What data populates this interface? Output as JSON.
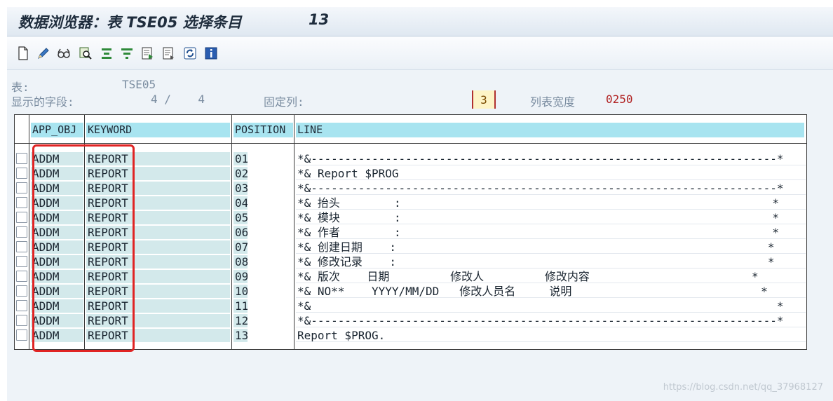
{
  "title": {
    "text": "数据浏览器：表 TSE05 选择条目",
    "count": "13"
  },
  "toolbar": {
    "buttons": [
      {
        "name": "new-page-icon"
      },
      {
        "name": "pencil-icon"
      },
      {
        "name": "glasses-icon"
      },
      {
        "name": "magnifier-icon"
      },
      {
        "name": "sort-ascending-icon"
      },
      {
        "name": "filter-icon"
      },
      {
        "name": "export-icon"
      },
      {
        "name": "detail-icon"
      },
      {
        "name": "refresh-icon"
      },
      {
        "name": "info-icon"
      }
    ]
  },
  "info": {
    "table_label": "表:",
    "table_value": "TSE05",
    "fields_label": "显示的字段:",
    "fields_value": "4 /    4",
    "fixed_cols_label": "固定列:",
    "fixed_cols_value": "3",
    "list_width_label": "列表宽度",
    "list_width_value": "0250"
  },
  "grid": {
    "headers": [
      "APP_OBJ",
      "KEYWORD",
      "POSITION",
      "LINE"
    ],
    "rows": [
      {
        "app_obj": "ADDM",
        "keyword": "REPORT",
        "position": "01",
        "line": "*&---------------------------------------------------------------------*"
      },
      {
        "app_obj": "ADDM",
        "keyword": "REPORT",
        "position": "02",
        "line": "*& Report $PROG"
      },
      {
        "app_obj": "ADDM",
        "keyword": "REPORT",
        "position": "03",
        "line": "*&---------------------------------------------------------------------*"
      },
      {
        "app_obj": "ADDM",
        "keyword": "REPORT",
        "position": "04",
        "line": "*& 抬头        :                                                       *"
      },
      {
        "app_obj": "ADDM",
        "keyword": "REPORT",
        "position": "05",
        "line": "*& 模块        :                                                       *"
      },
      {
        "app_obj": "ADDM",
        "keyword": "REPORT",
        "position": "06",
        "line": "*& 作者        :                                                       *"
      },
      {
        "app_obj": "ADDM",
        "keyword": "REPORT",
        "position": "07",
        "line": "*& 创建日期    :                                                       *"
      },
      {
        "app_obj": "ADDM",
        "keyword": "REPORT",
        "position": "08",
        "line": "*& 修改记录    :                                                       *"
      },
      {
        "app_obj": "ADDM",
        "keyword": "REPORT",
        "position": "09",
        "line": "*& 版次    日期         修改人         修改内容                        *"
      },
      {
        "app_obj": "ADDM",
        "keyword": "REPORT",
        "position": "10",
        "line": "*& NO**    YYYY/MM/DD   修改人员名     说明                            *"
      },
      {
        "app_obj": "ADDM",
        "keyword": "REPORT",
        "position": "11",
        "line": "*&                                                                     *"
      },
      {
        "app_obj": "ADDM",
        "keyword": "REPORT",
        "position": "12",
        "line": "*&---------------------------------------------------------------------*"
      },
      {
        "app_obj": "ADDM",
        "keyword": "REPORT",
        "position": "13",
        "line": "Report $PROG."
      }
    ]
  },
  "watermark": "https://blog.csdn.net/qq_37968127",
  "colors": {
    "header_bg": "#a8e4f0",
    "key_bg": "#d3e9eb",
    "highlight_border": "#e02424"
  }
}
